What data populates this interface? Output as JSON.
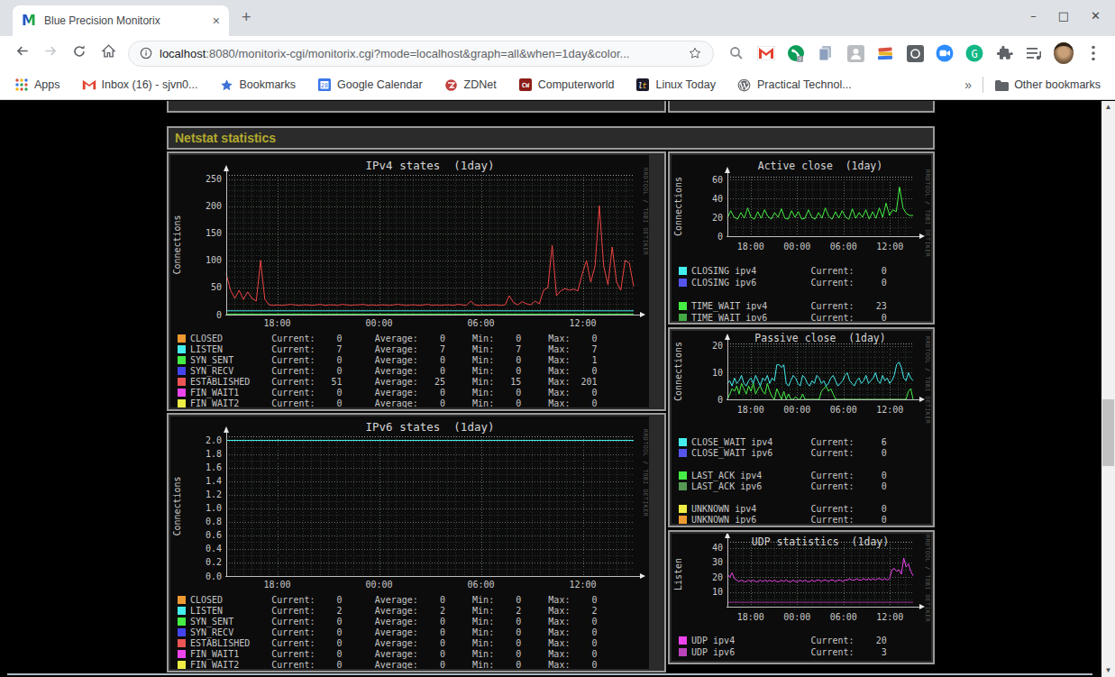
{
  "browser": {
    "tab_title": "Blue Precision Monitorix",
    "tab_close": "×",
    "new_tab": "+",
    "window_controls": {
      "minimize": "–",
      "maximize": "□",
      "close": "✕"
    },
    "nav": {
      "back": "←",
      "forward": "→"
    },
    "url": {
      "host": "localhost",
      "rest": ":8080/monitorix-cgi/monitorix.cgi?mode=localhost&graph=all&when=1day&color..."
    },
    "bookmarks": [
      {
        "icon": "apps-grid",
        "label": "Apps"
      },
      {
        "icon": "gmail",
        "label": "Inbox (16) - sjvn0..."
      },
      {
        "icon": "star",
        "label": "Bookmarks"
      },
      {
        "icon": "calendar",
        "label": "Google Calendar"
      },
      {
        "icon": "zdnet",
        "label": "ZDNet"
      },
      {
        "icon": "computerworld",
        "label": "Computerworld"
      },
      {
        "icon": "linuxtoday",
        "label": "Linux Today"
      },
      {
        "icon": "wordpress",
        "label": "Practical Technol..."
      }
    ],
    "overflow_chevron": "»",
    "other_bookmarks": "Other bookmarks",
    "extension_icons": [
      "search",
      "gmail",
      "voice",
      "copy-pages",
      "profile-square",
      "books-stack",
      "dark-square",
      "zoom-meet",
      "grammarly",
      "extensions-puzzle",
      "media-queue",
      "avatar",
      "menu-kebab"
    ]
  },
  "page": {
    "section_title": "Netstat statistics"
  },
  "charts": [
    {
      "id": "ipv4",
      "title": "IPv4 states  (1day)",
      "ylabel": "Connections",
      "watermark": "RRDTOOL / TOBI OETIKER",
      "ymax": 258,
      "yticks": [
        {
          "v": 0,
          "t": "0"
        },
        {
          "v": 50,
          "t": "50"
        },
        {
          "v": 100,
          "t": "100"
        },
        {
          "v": 150,
          "t": "150"
        },
        {
          "v": 200,
          "t": "200"
        },
        {
          "v": 250,
          "t": "250"
        }
      ],
      "grid": {
        "y_minor": 10,
        "y_major": 50
      },
      "xticks": [
        {
          "f": 0.125,
          "t": "18:00"
        },
        {
          "f": 0.375,
          "t": "00:00"
        },
        {
          "f": 0.625,
          "t": "06:00"
        },
        {
          "f": 0.875,
          "t": "12:00"
        }
      ],
      "series": [
        {
          "name": "SYN_SENT",
          "color": "#44ee44",
          "values": [
            1,
            1
          ]
        },
        {
          "name": "LISTEN",
          "color": "#44eeee",
          "values": [
            7,
            7
          ]
        },
        {
          "name": "ESTABLISHED",
          "color": "#ee4444",
          "values": [
            75,
            45,
            30,
            45,
            28,
            42,
            30,
            25,
            100,
            28,
            18,
            17,
            18,
            17,
            18,
            19,
            18,
            17,
            18,
            18,
            17,
            18,
            19,
            17,
            18,
            18,
            17,
            19,
            18,
            17,
            18,
            18,
            19,
            17,
            18,
            17,
            18,
            18,
            17,
            18,
            19,
            18,
            17,
            18,
            18,
            17,
            18,
            19,
            17,
            18,
            17,
            18,
            18,
            17,
            19,
            18,
            17,
            25,
            18,
            17,
            18,
            17,
            18,
            18,
            17,
            18,
            35,
            22,
            18,
            24,
            20,
            18,
            25,
            20,
            45,
            50,
            128,
            35,
            44,
            48,
            45,
            47,
            44,
            75,
            100,
            60,
            90,
            201,
            90,
            55,
            125,
            60,
            45,
            100,
            95,
            52
          ]
        }
      ],
      "legend": [
        {
          "color": "#ee9932",
          "label": "CLOSED",
          "current": 0,
          "average": 0,
          "min": 0,
          "max": 0,
          "group": 0
        },
        {
          "color": "#44eeee",
          "label": "LISTEN",
          "current": 7,
          "average": 7,
          "min": 7,
          "max": 7,
          "group": 0
        },
        {
          "color": "#44ee44",
          "label": "SYN_SENT",
          "current": 0,
          "average": 0,
          "min": 0,
          "max": 1,
          "group": 0
        },
        {
          "color": "#4444ee",
          "label": "SYN_RECV",
          "current": 0,
          "average": 0,
          "min": 0,
          "max": 0,
          "group": 0
        },
        {
          "color": "#ee5555",
          "label": "ESTABLISHED",
          "current": 51,
          "average": 25,
          "min": 15,
          "max": 201,
          "group": 0
        },
        {
          "color": "#ee44ee",
          "label": "FIN_WAIT1",
          "current": 0,
          "average": 0,
          "min": 0,
          "max": 0,
          "group": 0
        },
        {
          "color": "#eeee44",
          "label": "FIN_WAIT2",
          "current": 0,
          "average": 0,
          "min": 0,
          "max": 0,
          "group": 0
        }
      ]
    },
    {
      "id": "ipv6",
      "title": "IPv6 states  (1day)",
      "ylabel": "Connections",
      "watermark": "RRDTOOL / TOBI OETIKER",
      "ymax": 2.06,
      "yticks": [
        {
          "v": 0,
          "t": "0.0"
        },
        {
          "v": 0.2,
          "t": "0.2"
        },
        {
          "v": 0.4,
          "t": "0.4"
        },
        {
          "v": 0.6,
          "t": "0.6"
        },
        {
          "v": 0.8,
          "t": "0.8"
        },
        {
          "v": 1.0,
          "t": "1.0"
        },
        {
          "v": 1.2,
          "t": "1.2"
        },
        {
          "v": 1.4,
          "t": "1.4"
        },
        {
          "v": 1.6,
          "t": "1.6"
        },
        {
          "v": 1.8,
          "t": "1.8"
        },
        {
          "v": 2.0,
          "t": "2.0"
        }
      ],
      "grid": {
        "y_minor": 0.1,
        "y_major": 0.2
      },
      "xticks": [
        {
          "f": 0.125,
          "t": "18:00"
        },
        {
          "f": 0.375,
          "t": "00:00"
        },
        {
          "f": 0.625,
          "t": "06:00"
        },
        {
          "f": 0.875,
          "t": "12:00"
        }
      ],
      "series": [
        {
          "name": "LISTEN",
          "color": "#44eeee",
          "values": [
            2,
            2
          ]
        }
      ],
      "legend": [
        {
          "color": "#ee9932",
          "label": "CLOSED",
          "current": 0,
          "average": 0,
          "min": 0,
          "max": 0,
          "group": 0
        },
        {
          "color": "#44eeee",
          "label": "LISTEN",
          "current": 2,
          "average": 2,
          "min": 2,
          "max": 2,
          "group": 0
        },
        {
          "color": "#44ee44",
          "label": "SYN_SENT",
          "current": 0,
          "average": 0,
          "min": 0,
          "max": 0,
          "group": 0
        },
        {
          "color": "#4444ee",
          "label": "SYN_RECV",
          "current": 0,
          "average": 0,
          "min": 0,
          "max": 0,
          "group": 0
        },
        {
          "color": "#ee5555",
          "label": "ESTABLISHED",
          "current": 0,
          "average": 0,
          "min": 0,
          "max": 0,
          "group": 0
        },
        {
          "color": "#ee44ee",
          "label": "FIN_WAIT1",
          "current": 0,
          "average": 0,
          "min": 0,
          "max": 0,
          "group": 0
        },
        {
          "color": "#eeee44",
          "label": "FIN_WAIT2",
          "current": 0,
          "average": 0,
          "min": 0,
          "max": 0,
          "group": 0
        }
      ]
    },
    {
      "id": "active",
      "title": "Active close  (1day)",
      "ylabel": "Connections",
      "watermark": "RRDTOOL / TOBI OETIKER",
      "ymax": 63,
      "yticks": [
        {
          "v": 0,
          "t": "0"
        },
        {
          "v": 20,
          "t": "20"
        },
        {
          "v": 40,
          "t": "40"
        },
        {
          "v": 60,
          "t": "60"
        }
      ],
      "grid": {
        "y_minor": 10,
        "y_major": 20
      },
      "xticks": [
        {
          "f": 0.125,
          "t": "18:00"
        },
        {
          "f": 0.375,
          "t": "00:00"
        },
        {
          "f": 0.625,
          "t": "06:00"
        },
        {
          "f": 0.875,
          "t": "12:00"
        }
      ],
      "series": [
        {
          "name": "TIME_WAIT ipv4",
          "color": "#44ee44",
          "values": [
            19,
            27,
            20,
            18,
            25,
            19,
            30,
            20,
            18,
            26,
            19,
            28,
            21,
            18,
            25,
            20,
            29,
            19,
            18,
            27,
            20,
            26,
            18,
            19,
            28,
            20,
            18,
            25,
            19,
            30,
            21,
            18,
            26,
            19,
            27,
            20,
            18,
            29,
            19,
            25,
            20,
            28,
            18,
            26,
            19,
            30,
            20,
            35,
            22,
            28,
            26,
            52,
            30,
            24,
            22,
            22
          ]
        }
      ],
      "legend": [
        {
          "color": "#44eeee",
          "label": "CLOSING ipv4",
          "current": 0,
          "group": 0
        },
        {
          "color": "#5555ee",
          "label": "CLOSING ipv6",
          "current": 0,
          "group": 0
        },
        {
          "color": "#44ee44",
          "label": "TIME_WAIT ipv4",
          "current": 23,
          "group": 1
        },
        {
          "color": "#44aa44",
          "label": "TIME_WAIT ipv6",
          "current": 0,
          "group": 1
        }
      ]
    },
    {
      "id": "passive",
      "title": "Passive close  (1day)",
      "ylabel": "Connections",
      "watermark": "RRDTOOL / TOBI OETIKER",
      "ymax": 21,
      "yticks": [
        {
          "v": 0,
          "t": "0"
        },
        {
          "v": 10,
          "t": "10"
        },
        {
          "v": 20,
          "t": "20"
        }
      ],
      "grid": {
        "y_minor": 2,
        "y_major": 10
      },
      "xticks": [
        {
          "f": 0.125,
          "t": "18:00"
        },
        {
          "f": 0.375,
          "t": "00:00"
        },
        {
          "f": 0.625,
          "t": "06:00"
        },
        {
          "f": 0.875,
          "t": "12:00"
        }
      ],
      "series": [
        {
          "name": "LAST_ACK ipv4",
          "color": "#44ee44",
          "values": [
            0,
            2,
            4,
            3,
            5,
            2,
            6,
            4,
            2,
            5,
            3,
            6,
            2,
            4,
            5,
            3,
            2,
            6,
            3,
            1,
            0,
            4,
            2,
            0,
            3,
            0,
            2,
            0,
            0,
            1,
            0,
            0,
            2,
            0,
            0,
            0,
            0,
            0,
            0,
            0,
            3,
            4,
            5,
            3,
            4,
            2,
            0,
            0,
            0,
            0,
            0,
            0,
            0,
            0,
            0,
            0,
            0,
            0,
            0,
            0,
            0,
            0,
            0,
            0,
            0,
            0,
            0,
            0,
            0,
            0,
            0,
            0,
            0,
            0,
            0,
            0,
            0,
            3,
            4,
            0
          ]
        },
        {
          "name": "CLOSE_WAIT ipv4",
          "color": "#44eeee",
          "values": [
            6,
            7,
            5,
            8,
            6,
            7,
            9,
            6,
            5,
            7,
            8,
            6,
            9,
            7,
            5,
            8,
            7,
            9,
            6,
            8,
            7,
            13,
            13,
            12,
            13,
            6,
            5,
            7,
            9,
            8,
            6,
            5,
            9,
            8,
            6,
            5,
            7,
            6,
            9,
            8,
            6,
            7,
            5,
            6,
            8,
            9,
            7,
            5,
            6,
            7,
            9,
            10,
            7,
            6,
            5,
            7,
            8,
            6,
            7,
            9,
            6,
            7,
            8,
            10,
            7,
            6,
            9,
            7,
            8,
            6,
            7,
            9,
            13,
            14,
            12,
            8,
            7,
            10,
            8,
            7
          ]
        }
      ],
      "legend": [
        {
          "color": "#44eeee",
          "label": "CLOSE_WAIT ipv4",
          "current": 6,
          "group": 0
        },
        {
          "color": "#5555ee",
          "label": "CLOSE_WAIT ipv6",
          "current": 0,
          "group": 0
        },
        {
          "color": "#44ee44",
          "label": "LAST_ACK ipv4",
          "current": 0,
          "group": 1
        },
        {
          "color": "#559955",
          "label": "LAST_ACK ipv6",
          "current": 0,
          "group": 1
        },
        {
          "color": "#eeee44",
          "label": "UNKNOWN ipv4",
          "current": 0,
          "group": 2
        },
        {
          "color": "#ee9932",
          "label": "UNKNOWN ipv6",
          "current": 0,
          "group": 2
        }
      ]
    },
    {
      "id": "udp",
      "title": "UDP statistics  (1day)",
      "ylabel": "Listen",
      "watermark": "RRDTOOL / TOBI OETIKER",
      "ymax": 44,
      "yticks": [
        {
          "v": 10,
          "t": "10"
        },
        {
          "v": 20,
          "t": "20"
        },
        {
          "v": 30,
          "t": "30"
        },
        {
          "v": 40,
          "t": "40"
        }
      ],
      "grid": {
        "y_minor": 5,
        "y_major": 10
      },
      "xticks": [
        {
          "f": 0.125,
          "t": "18:00"
        },
        {
          "f": 0.375,
          "t": "00:00"
        },
        {
          "f": 0.625,
          "t": "06:00"
        },
        {
          "f": 0.875,
          "t": "12:00"
        }
      ],
      "series": [
        {
          "name": "UDP ipv6",
          "color": "#993399",
          "values": [
            3,
            3
          ]
        },
        {
          "name": "UDP ipv4",
          "color": "#ee44ee",
          "values": [
            22,
            20,
            23,
            19,
            18,
            17,
            18,
            17,
            17,
            18,
            17,
            18,
            17,
            17,
            18,
            17,
            18,
            17,
            18,
            17,
            18,
            17,
            17,
            18,
            17,
            18,
            17,
            17,
            18,
            17,
            17,
            18,
            17,
            18,
            17,
            17,
            18,
            17,
            18,
            18,
            17,
            18,
            18,
            17,
            18,
            18,
            17,
            18,
            18,
            17,
            18,
            18,
            19,
            18,
            18,
            19,
            18,
            18,
            19,
            18,
            19,
            18,
            19,
            18,
            19,
            19,
            18,
            19,
            18,
            19,
            25,
            26,
            24,
            25,
            22,
            33,
            27,
            29,
            24,
            21
          ]
        }
      ],
      "legend": [
        {
          "color": "#ee44ee",
          "label": "UDP ipv4",
          "current": 20,
          "group": 0
        },
        {
          "color": "#bb44bb",
          "label": "UDP ipv6",
          "current": 3,
          "group": 0
        }
      ]
    }
  ]
}
